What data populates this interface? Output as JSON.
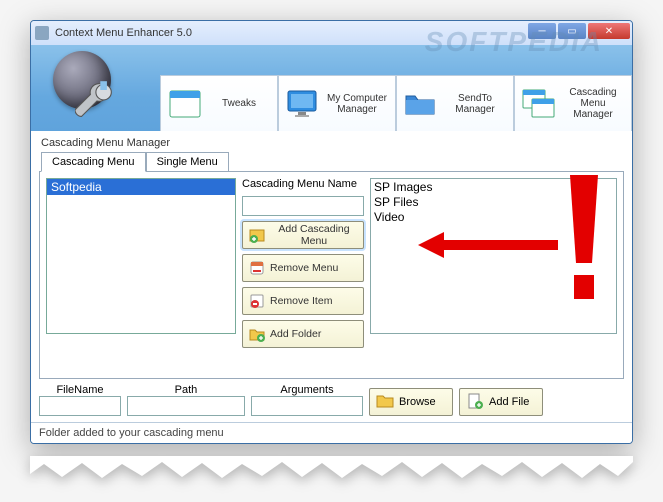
{
  "window": {
    "title": "Context Menu Enhancer 5.0"
  },
  "watermark": "SOFTPEDIA",
  "nav": [
    {
      "label": "Tweaks"
    },
    {
      "label": "My Computer Manager"
    },
    {
      "label": "SendTo Manager"
    },
    {
      "label": "Cascading Menu Manager"
    }
  ],
  "section_title": "Cascading Menu Manager",
  "subtabs": {
    "active": "Cascading Menu",
    "other": "Single Menu"
  },
  "left_list": {
    "selected": "Softpedia"
  },
  "mid": {
    "name_label": "Cascading Menu Name",
    "add_cascading": "Add Cascading Menu",
    "remove_menu": "Remove Menu",
    "remove_item": "Remove Item",
    "add_folder": "Add Folder"
  },
  "right_list": [
    "SP Images",
    "SP Files",
    "Video"
  ],
  "bottom": {
    "filename_label": "FileName",
    "path_label": "Path",
    "arguments_label": "Arguments",
    "browse": "Browse",
    "add_file": "Add File"
  },
  "status": "Folder added to your cascading menu"
}
